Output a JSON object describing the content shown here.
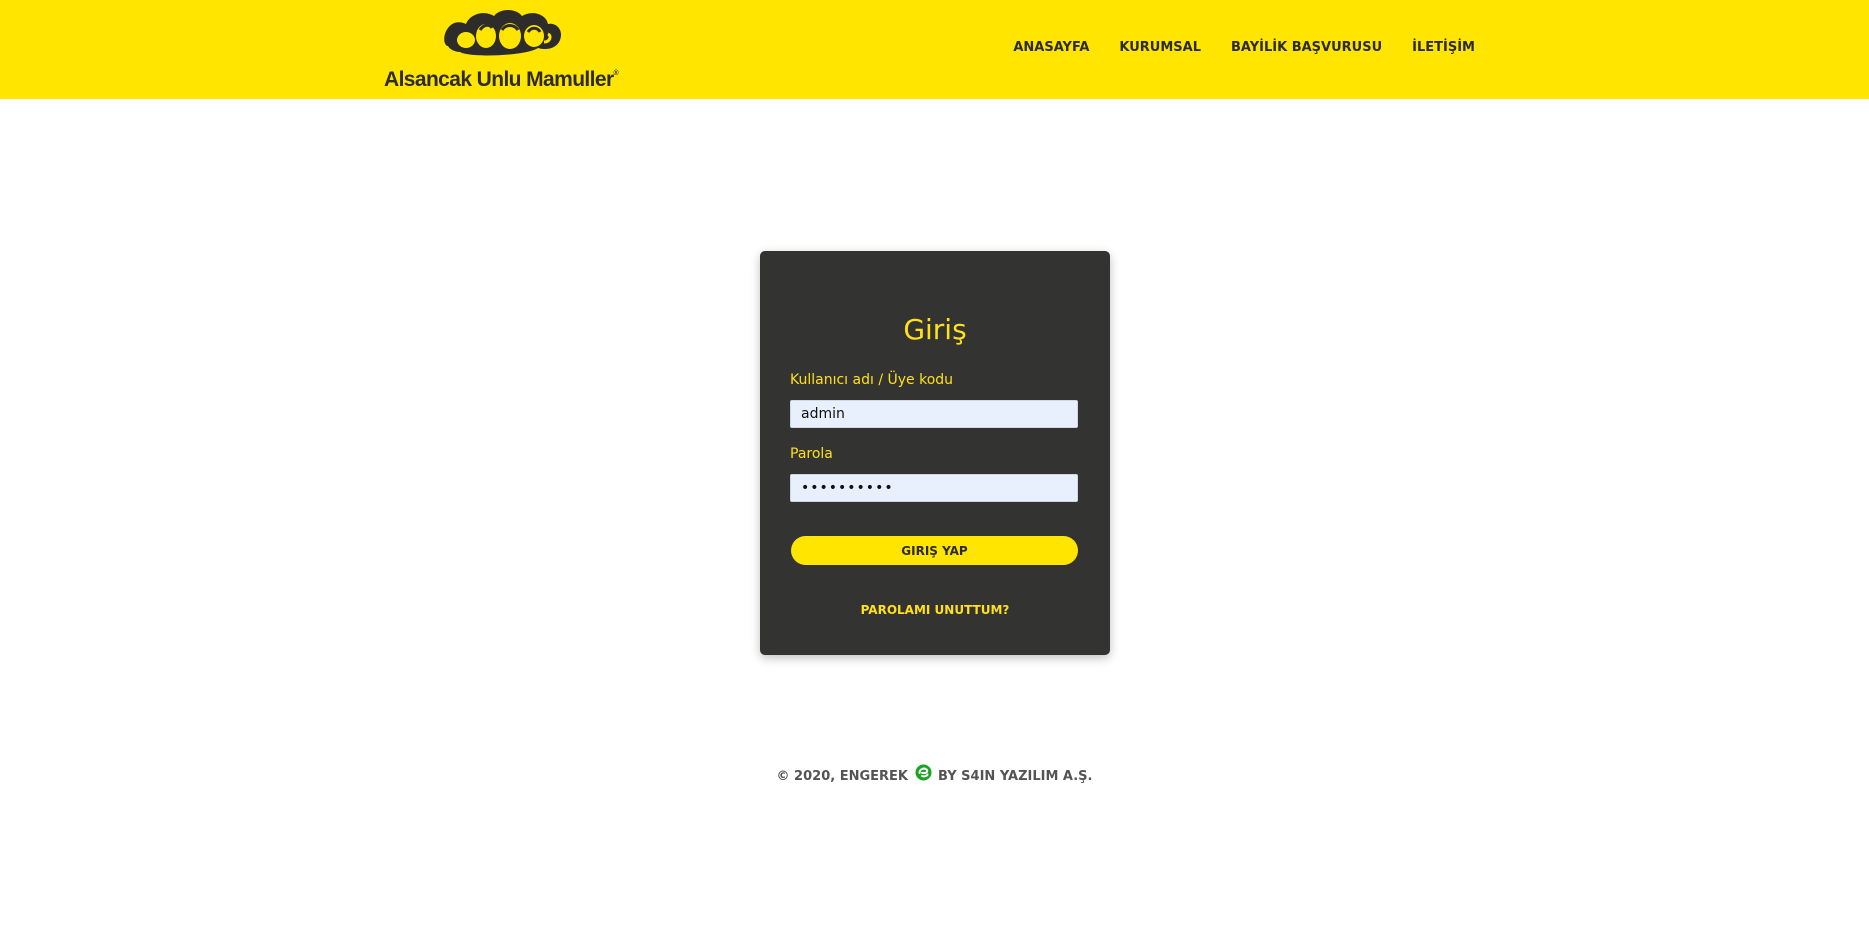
{
  "header": {
    "logo_text": "Alsancak Unlu Mamuller",
    "logo_mark": "®",
    "nav": [
      {
        "label": "ANASAYFA"
      },
      {
        "label": "KURUMSAL"
      },
      {
        "label": "BAYİLİK BAŞVURUSU"
      },
      {
        "label": "İLETİŞİM"
      }
    ],
    "colors": {
      "background": "#ffe500",
      "text": "#2b2b2b"
    }
  },
  "login": {
    "title": "Giriş",
    "username_label": "Kullanıcı adı / Üye kodu",
    "username_value": "admin",
    "password_label": "Parola",
    "password_value": "••••••••••",
    "submit_label": "GIRIŞ YAP",
    "forgot_label": "PAROLAMI UNUTTUM?",
    "colors": {
      "card": "#333331",
      "accent": "#ffe01b",
      "input_bg": "#e8f0fe"
    }
  },
  "footer": {
    "prefix": "© 2020, ENGEREK",
    "icon": "engerek-logo-icon",
    "suffix": "BY S4IN YAZILIM A.Ş.",
    "icon_color": "#1aa323"
  }
}
